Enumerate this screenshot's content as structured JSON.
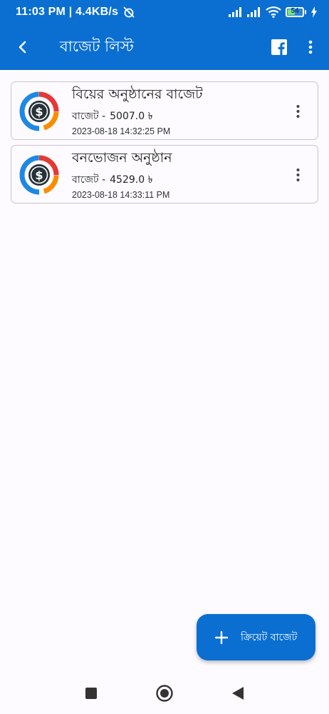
{
  "status": {
    "time": "11:03 PM | 4.4KB/s",
    "battery": "54",
    "battery_level": 0.54,
    "icons": [
      "alarm-off-icon",
      "signal-icon",
      "signal-icon",
      "wifi-icon",
      "battery-icon",
      "charging-icon"
    ]
  },
  "appbar": {
    "title": "বাজেট লিস্ট",
    "icons": [
      "back-arrow-icon",
      "facebook-icon",
      "more-vert-icon"
    ]
  },
  "budgets": [
    {
      "name": "বিয়ের অনুষ্ঠানের বাজেট",
      "amount_label": "বাজেট -",
      "amount": "5007.0 ৳",
      "date": "2023-08-18 14:32:25 PM"
    },
    {
      "name": "বনভোজন অনুষ্ঠান",
      "amount_label": "বাজেট -",
      "amount": "4529.0 ৳",
      "date": "2023-08-18 14:33:11 PM"
    }
  ],
  "fab": {
    "label": "ক্রিয়েট বাজেট",
    "icon": "plus-icon"
  },
  "navbar": {
    "icons": [
      "recents-square-icon",
      "home-circle-icon",
      "back-triangle-icon"
    ]
  },
  "colors": {
    "primary": "#0a6fd1",
    "background": "#fdfbff",
    "card_border": "#c9c5cc"
  }
}
